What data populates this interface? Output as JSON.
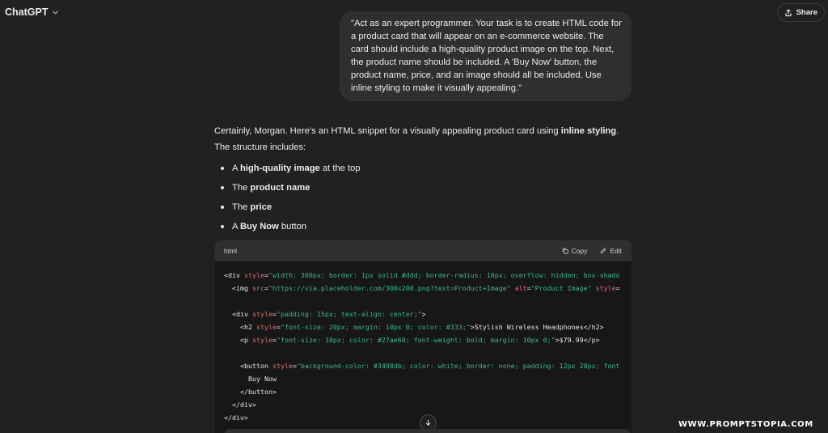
{
  "header": {
    "app_title": "ChatGPT",
    "share_label": "Share"
  },
  "user_message": {
    "text": "\"Act as an expert programmer. Your task is to create HTML code for a product card that will appear on an e-commerce website. The card should include a high-quality product image on the top. Next, the product name should be included. A 'Buy Now' button, the product name, price, and an image should all be included. Use inline styling to make it visually appealing.\""
  },
  "assistant": {
    "intro_part1": "Certainly, Morgan. Here's an HTML snippet for a visually appealing product card using ",
    "intro_bold": "inline styling",
    "intro_part2": ". The structure includes:",
    "bullets": [
      {
        "pre": "A ",
        "bold": "high-quality image",
        "post": " at the top"
      },
      {
        "pre": "The ",
        "bold": "product name",
        "post": ""
      },
      {
        "pre": "The ",
        "bold": "price",
        "post": ""
      },
      {
        "pre": "A ",
        "bold": "Buy Now",
        "post": " button"
      }
    ]
  },
  "code_block": {
    "language": "html",
    "copy_label": "Copy",
    "edit_label": "Edit",
    "lines": [
      [
        [
          "t",
          "<div "
        ],
        [
          "a",
          "style"
        ],
        [
          "t",
          "="
        ],
        [
          "s",
          "\"width: 300px; border: 1px solid #ddd; border-radius: 10px; overflow: hidden; box-shado"
        ]
      ],
      [
        [
          "t",
          "  <img "
        ],
        [
          "a",
          "src"
        ],
        [
          "t",
          "="
        ],
        [
          "s",
          "\"https://via.placeholder.com/300x200.png?text=Product+Image\" "
        ],
        [
          "a",
          "alt"
        ],
        [
          "t",
          "="
        ],
        [
          "s",
          "\"Product Image\" "
        ],
        [
          "a",
          "style"
        ],
        [
          "t",
          "="
        ]
      ],
      [
        [
          "t",
          ""
        ]
      ],
      [
        [
          "t",
          "  <div "
        ],
        [
          "a",
          "style"
        ],
        [
          "t",
          "="
        ],
        [
          "s",
          "\"padding: 15px; text-align: center;\""
        ],
        [
          "t",
          ">"
        ]
      ],
      [
        [
          "t",
          "    <h2 "
        ],
        [
          "a",
          "style"
        ],
        [
          "t",
          "="
        ],
        [
          "s",
          "\"font-size: 20px; margin: 10px 0; color: #333;\""
        ],
        [
          "t",
          ">Stylish Wireless Headphones</h2>"
        ]
      ],
      [
        [
          "t",
          "    <p "
        ],
        [
          "a",
          "style"
        ],
        [
          "t",
          "="
        ],
        [
          "s",
          "\"font-size: 18px; color: #27ae60; font-weight: bold; margin: 10px 0;\""
        ],
        [
          "t",
          ">$79.99</p>"
        ]
      ],
      [
        [
          "t",
          ""
        ]
      ],
      [
        [
          "t",
          "    <button "
        ],
        [
          "a",
          "style"
        ],
        [
          "t",
          "="
        ],
        [
          "s",
          "\"background-color: #3498db; color: white; border: none; padding: 12px 20px; font"
        ]
      ],
      [
        [
          "t",
          "      Buy Now"
        ]
      ],
      [
        [
          "t",
          "    </button>"
        ]
      ],
      [
        [
          "t",
          "  </div>"
        ]
      ],
      [
        [
          "t",
          "</div>"
        ]
      ]
    ]
  },
  "watermark": "WWW.PROMPTSTOPIA.COM",
  "colors": {
    "background": "#212121",
    "bubble": "#2f2f2f",
    "code_bg": "#171717",
    "code_attr": "#e06c75",
    "code_string": "#3fb68b"
  },
  "icons": [
    "chevron-down-icon",
    "share-icon",
    "copy-icon",
    "edit-icon",
    "arrow-down-icon"
  ]
}
